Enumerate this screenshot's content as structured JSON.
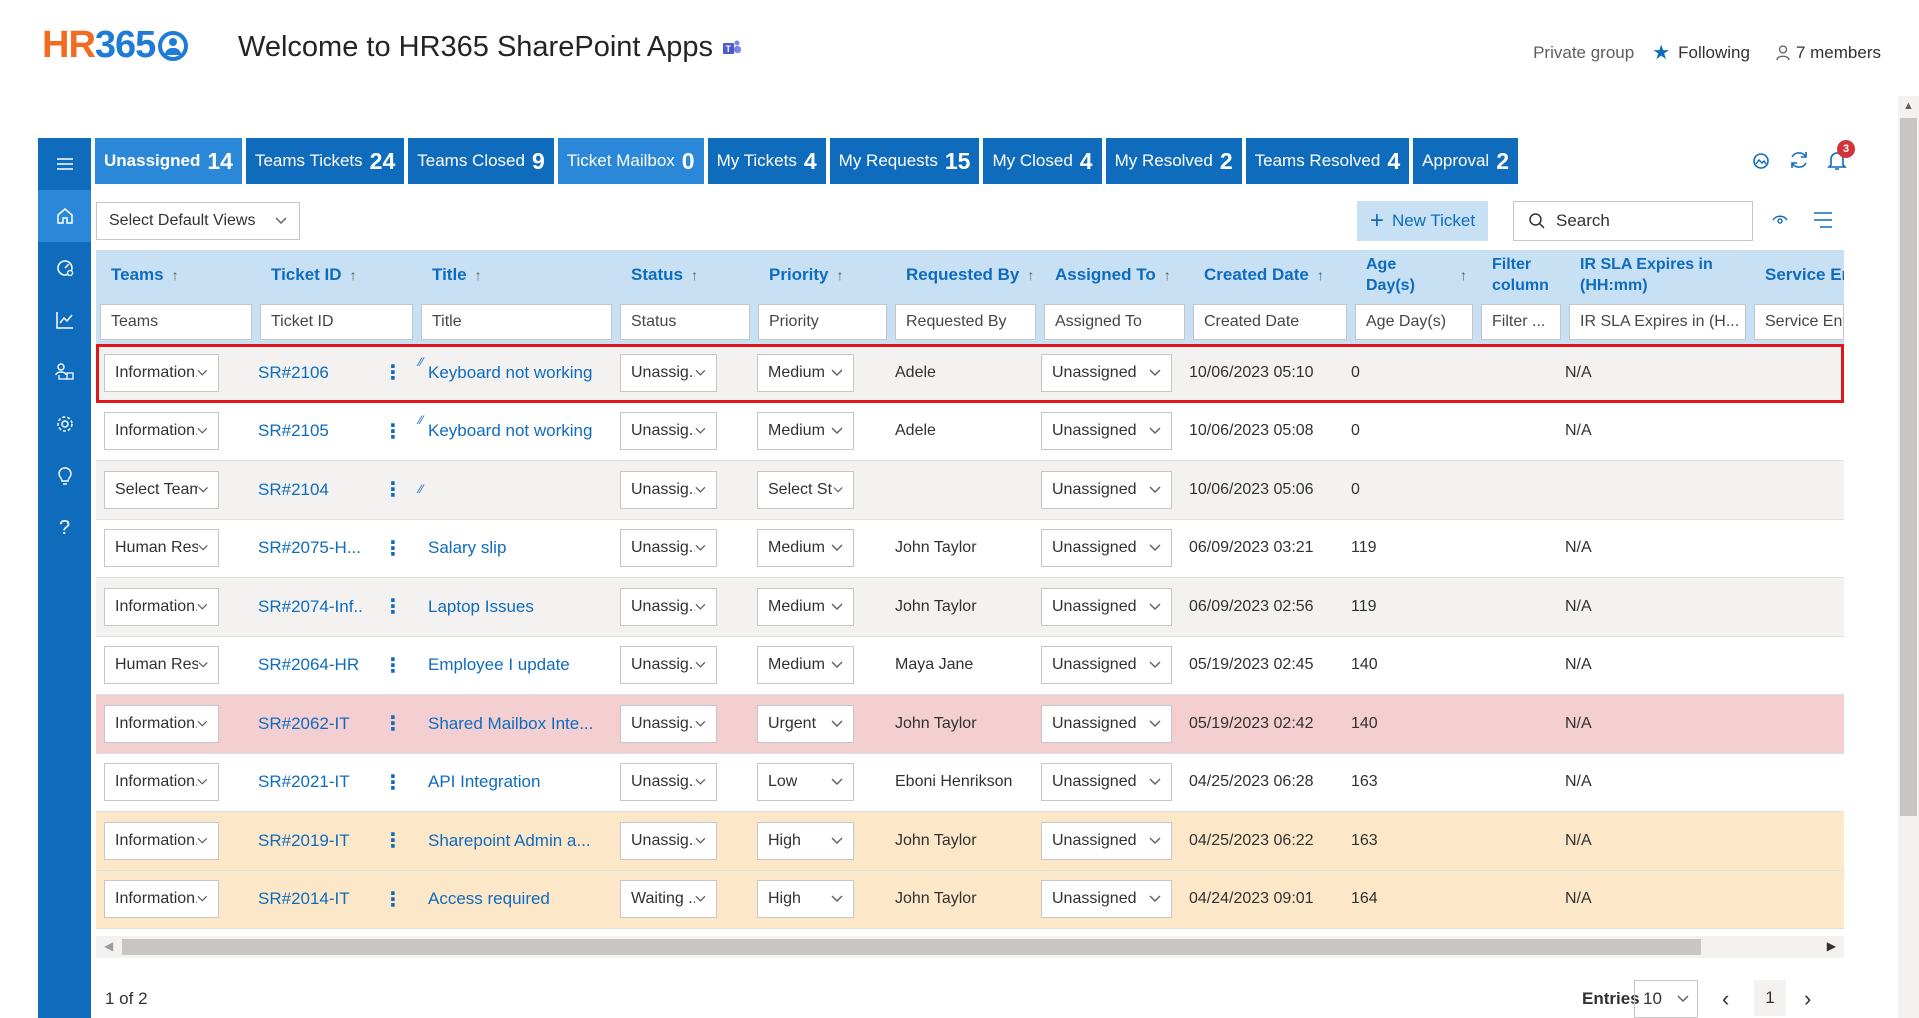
{
  "header": {
    "logo_hr": "HR",
    "logo_365": "365",
    "title": "Welcome to HR365 SharePoint Apps",
    "privacy": "Private group",
    "following": "Following",
    "members": "7 members"
  },
  "nav": [
    "menu-icon",
    "home-icon",
    "dashboard-icon",
    "chart-icon",
    "user-network-icon",
    "gear-icon",
    "lightbulb-icon",
    "help-icon"
  ],
  "tabs": [
    {
      "label": "Unassigned",
      "count": "14"
    },
    {
      "label": "Teams Tickets",
      "count": "24"
    },
    {
      "label": "Teams Closed",
      "count": "9"
    },
    {
      "label": "Ticket Mailbox",
      "count": "0"
    },
    {
      "label": "My Tickets",
      "count": "4"
    },
    {
      "label": "My Requests",
      "count": "15"
    },
    {
      "label": "My Closed",
      "count": "4"
    },
    {
      "label": "My Resolved",
      "count": "2"
    },
    {
      "label": "Teams Resolved",
      "count": "4"
    },
    {
      "label": "Approval",
      "count": "2"
    }
  ],
  "notifications": {
    "count": "3"
  },
  "toolbar": {
    "views": "Select Default Views",
    "new_ticket": "New Ticket",
    "search": "Search"
  },
  "columns": {
    "teams": "Teams",
    "ticket_id": "Ticket ID",
    "title": "Title",
    "status": "Status",
    "priority": "Priority",
    "requested_by": "Requested By",
    "assigned_to": "Assigned To",
    "created_date": "Created Date",
    "age": "Age Day(s)",
    "filter_col": "Filter column",
    "sla": "IR SLA Expires in (HH:mm)",
    "service": "Service Ent"
  },
  "filters": {
    "teams": "Teams",
    "ticket_id": "Ticket ID",
    "title": "Title",
    "status": "Status",
    "priority": "Priority",
    "requested_by": "Requested By",
    "assigned_to": "Assigned To",
    "created_date": "Created Date",
    "age": "Age Day(s)",
    "filter_col": "Filter ...",
    "sla": "IR SLA Expires in (H...",
    "service": "Service Enti"
  },
  "rows": [
    {
      "teams": "Information...",
      "id": "SR#2106",
      "title": "Keyboard not working",
      "status": "Unassig...",
      "priority": "Medium",
      "requested_by": "Adele",
      "assigned": "Unassigned",
      "created": "10/06/2023 05:10",
      "age": "0",
      "sla": "N/A"
    },
    {
      "teams": "Information...",
      "id": "SR#2105",
      "title": "Keyboard not working",
      "status": "Unassig...",
      "priority": "Medium",
      "requested_by": "Adele",
      "assigned": "Unassigned",
      "created": "10/06/2023 05:08",
      "age": "0",
      "sla": "N/A"
    },
    {
      "teams": "Select Teams",
      "id": "SR#2104",
      "title": "",
      "status": "Unassig...",
      "priority": "Select St...",
      "requested_by": "",
      "assigned": "Unassigned",
      "created": "10/06/2023 05:06",
      "age": "0",
      "sla": ""
    },
    {
      "teams": "Human Res...",
      "id": "SR#2075-H...",
      "title": "Salary slip",
      "status": "Unassig...",
      "priority": "Medium",
      "requested_by": "John Taylor",
      "assigned": "Unassigned",
      "created": "06/09/2023 03:21",
      "age": "119",
      "sla": "N/A"
    },
    {
      "teams": "Information...",
      "id": "SR#2074-Inf...",
      "title": "Laptop Issues",
      "status": "Unassig...",
      "priority": "Medium",
      "requested_by": "John Taylor",
      "assigned": "Unassigned",
      "created": "06/09/2023 02:56",
      "age": "119",
      "sla": "N/A"
    },
    {
      "teams": "Human Res...",
      "id": "SR#2064-HR",
      "title": "Employee I update",
      "status": "Unassig...",
      "priority": "Medium",
      "requested_by": "Maya Jane",
      "assigned": "Unassigned",
      "created": "05/19/2023 02:45",
      "age": "140",
      "sla": "N/A"
    },
    {
      "teams": "Information...",
      "id": "SR#2062-IT",
      "title": "Shared Mailbox Inte...",
      "status": "Unassig...",
      "priority": "Urgent",
      "requested_by": "John Taylor",
      "assigned": "Unassigned",
      "created": "05/19/2023 02:42",
      "age": "140",
      "sla": "N/A"
    },
    {
      "teams": "Information...",
      "id": "SR#2021-IT",
      "title": "API Integration",
      "status": "Unassig...",
      "priority": "Low",
      "requested_by": "Eboni Henrikson",
      "assigned": "Unassigned",
      "created": "04/25/2023 06:28",
      "age": "163",
      "sla": "N/A"
    },
    {
      "teams": "Information...",
      "id": "SR#2019-IT",
      "title": "Sharepoint Admin a...",
      "status": "Unassig...",
      "priority": "High",
      "requested_by": "John Taylor",
      "assigned": "Unassigned",
      "created": "04/25/2023 06:22",
      "age": "163",
      "sla": "N/A"
    },
    {
      "teams": "Information...",
      "id": "SR#2014-IT",
      "title": "Access required",
      "status": "Waiting ...",
      "priority": "High",
      "requested_by": "John Taylor",
      "assigned": "Unassigned",
      "created": "04/24/2023 09:01",
      "age": "164",
      "sla": "N/A"
    }
  ],
  "row_colors": {
    "urgent": "#f4cfd1",
    "high": "#fde7c9",
    "selected_outline": "#e0161d"
  },
  "footer": {
    "page_info": "1 of 2",
    "entries_label": "Entries",
    "entries_value": "10",
    "current_page": "1"
  }
}
